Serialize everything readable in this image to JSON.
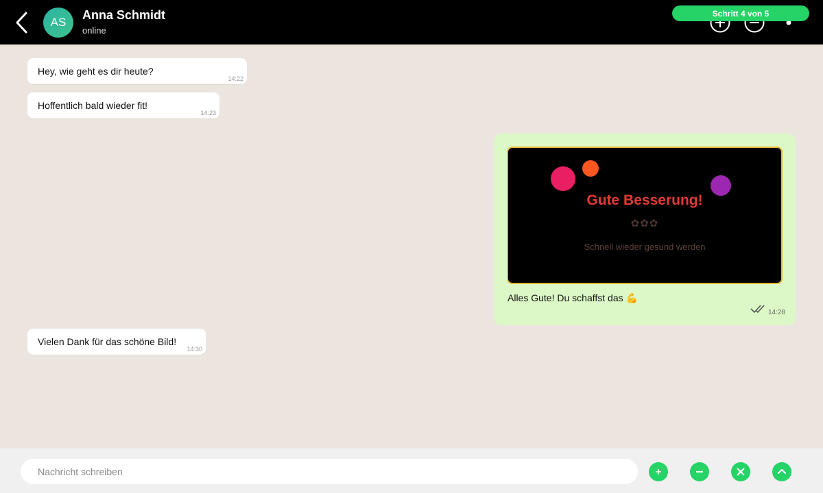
{
  "header": {
    "avatar_initials": "AS",
    "contact_name": "Anna Schmidt",
    "status": "online",
    "step_label": "Schritt 4 von 5",
    "icons": [
      "back-arrow-icon",
      "zoom-in-icon",
      "zoom-out-icon",
      "dot-icon"
    ]
  },
  "messages": [
    {
      "direction": "in",
      "text": "Hey, wie geht es dir heute?",
      "time": "14:22"
    },
    {
      "direction": "in",
      "text": "Hoffentlich bald wieder fit!",
      "time": "14:23"
    },
    {
      "direction": "out",
      "card": {
        "title": "Gute Besserung!",
        "flowers": "✿✿✿",
        "subtitle": "Schnell wieder gesund werden"
      },
      "caption": "Alles Gute! Du schaffst das 💪",
      "time": "14:28",
      "status_icon": "double-check-icon"
    },
    {
      "direction": "in",
      "text": "Vielen Dank für das schöne Bild!",
      "time": "14:30"
    }
  ],
  "input": {
    "placeholder": "Nachricht schreiben",
    "value": ""
  },
  "input_actions": [
    "plus-icon",
    "minus-icon",
    "close-icon",
    "chevron-up-icon"
  ],
  "colors": {
    "accent": "#25d366",
    "header_bg": "#000000",
    "chat_bg": "#ece5df",
    "outgoing_bubble": "#dcf8c6",
    "card_title": "#e53935",
    "card_border": "#e7b83a"
  }
}
